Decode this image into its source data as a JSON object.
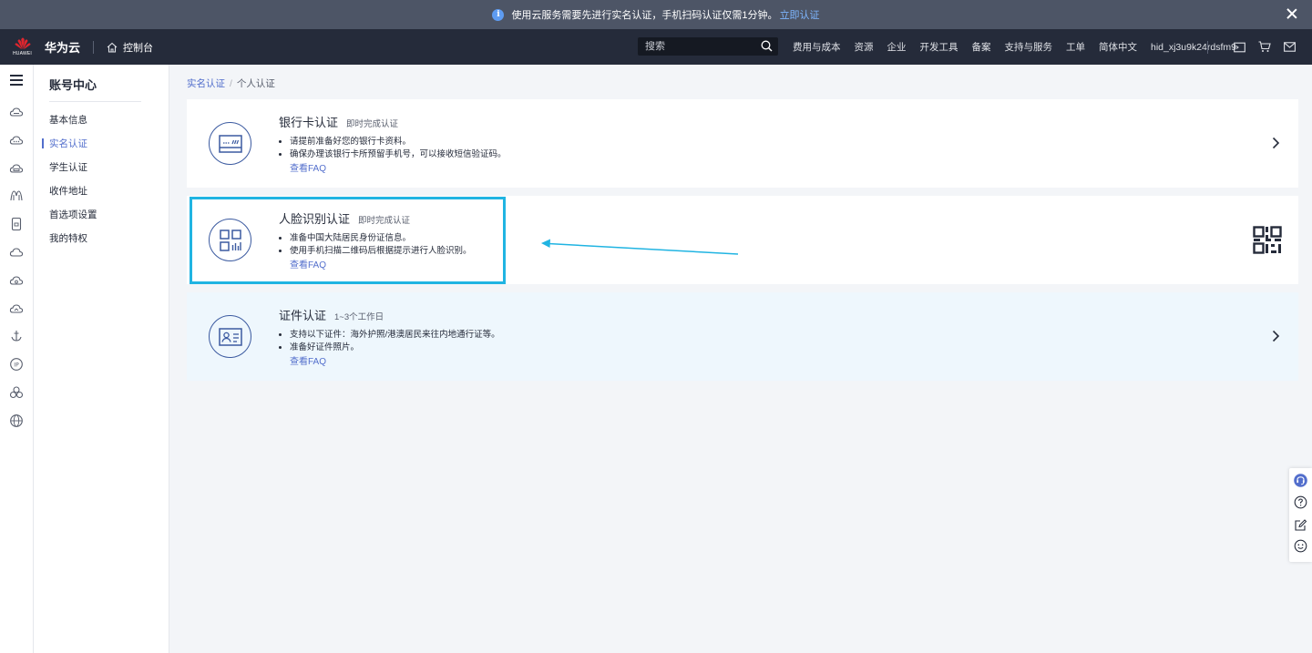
{
  "notice": {
    "text": "使用云服务需要先进行实名认证，手机扫码认证仅需1分钟。",
    "link": "立即认证"
  },
  "header": {
    "logo_text": "HUAWEI",
    "brand": "华为云",
    "console": "控制台",
    "search_placeholder": "搜索",
    "nav": [
      "费用与成本",
      "资源",
      "企业",
      "开发工具",
      "备案",
      "支持与服务",
      "工单",
      "简体中文"
    ],
    "user": "hid_xj3u9k24rdsfm9"
  },
  "sidebar": {
    "title": "账号中心",
    "items": [
      {
        "label": "基本信息"
      },
      {
        "label": "实名认证"
      },
      {
        "label": "学生认证"
      },
      {
        "label": "收件地址"
      },
      {
        "label": "首选项设置"
      },
      {
        "label": "我的特权"
      }
    ],
    "active_index": 1
  },
  "breadcrumb": {
    "parent": "实名认证",
    "current": "个人认证"
  },
  "cards": [
    {
      "title": "银行卡认证",
      "subtitle": "即时完成认证",
      "bullets": [
        "请提前准备好您的银行卡资料。",
        "确保办理该银行卡所预留手机号，可以接收短信验证码。"
      ],
      "faq": "查看FAQ",
      "icon": "bank-card-icon",
      "right_icon": "chevron-right-icon"
    },
    {
      "title": "人脸识别认证",
      "subtitle": "即时完成认证",
      "bullets": [
        "准备中国大陆居民身份证信息。",
        "使用手机扫描二维码后根据提示进行人脸识别。"
      ],
      "faq": "查看FAQ",
      "icon": "qr-apps-icon",
      "right_icon": "qr-code-icon"
    },
    {
      "title": "证件认证",
      "subtitle": "1~3个工作日",
      "bullets": [
        "支持以下证件：海外护照/港澳居民来往内地通行证等。",
        "准备好证件照片。"
      ],
      "faq": "查看FAQ",
      "icon": "id-card-icon",
      "right_icon": "chevron-right-icon"
    }
  ],
  "colors": {
    "accent": "#526ecc",
    "highlight": "#20b4e2",
    "header_bg": "#252b3a",
    "notice_bg": "#4d5566"
  }
}
